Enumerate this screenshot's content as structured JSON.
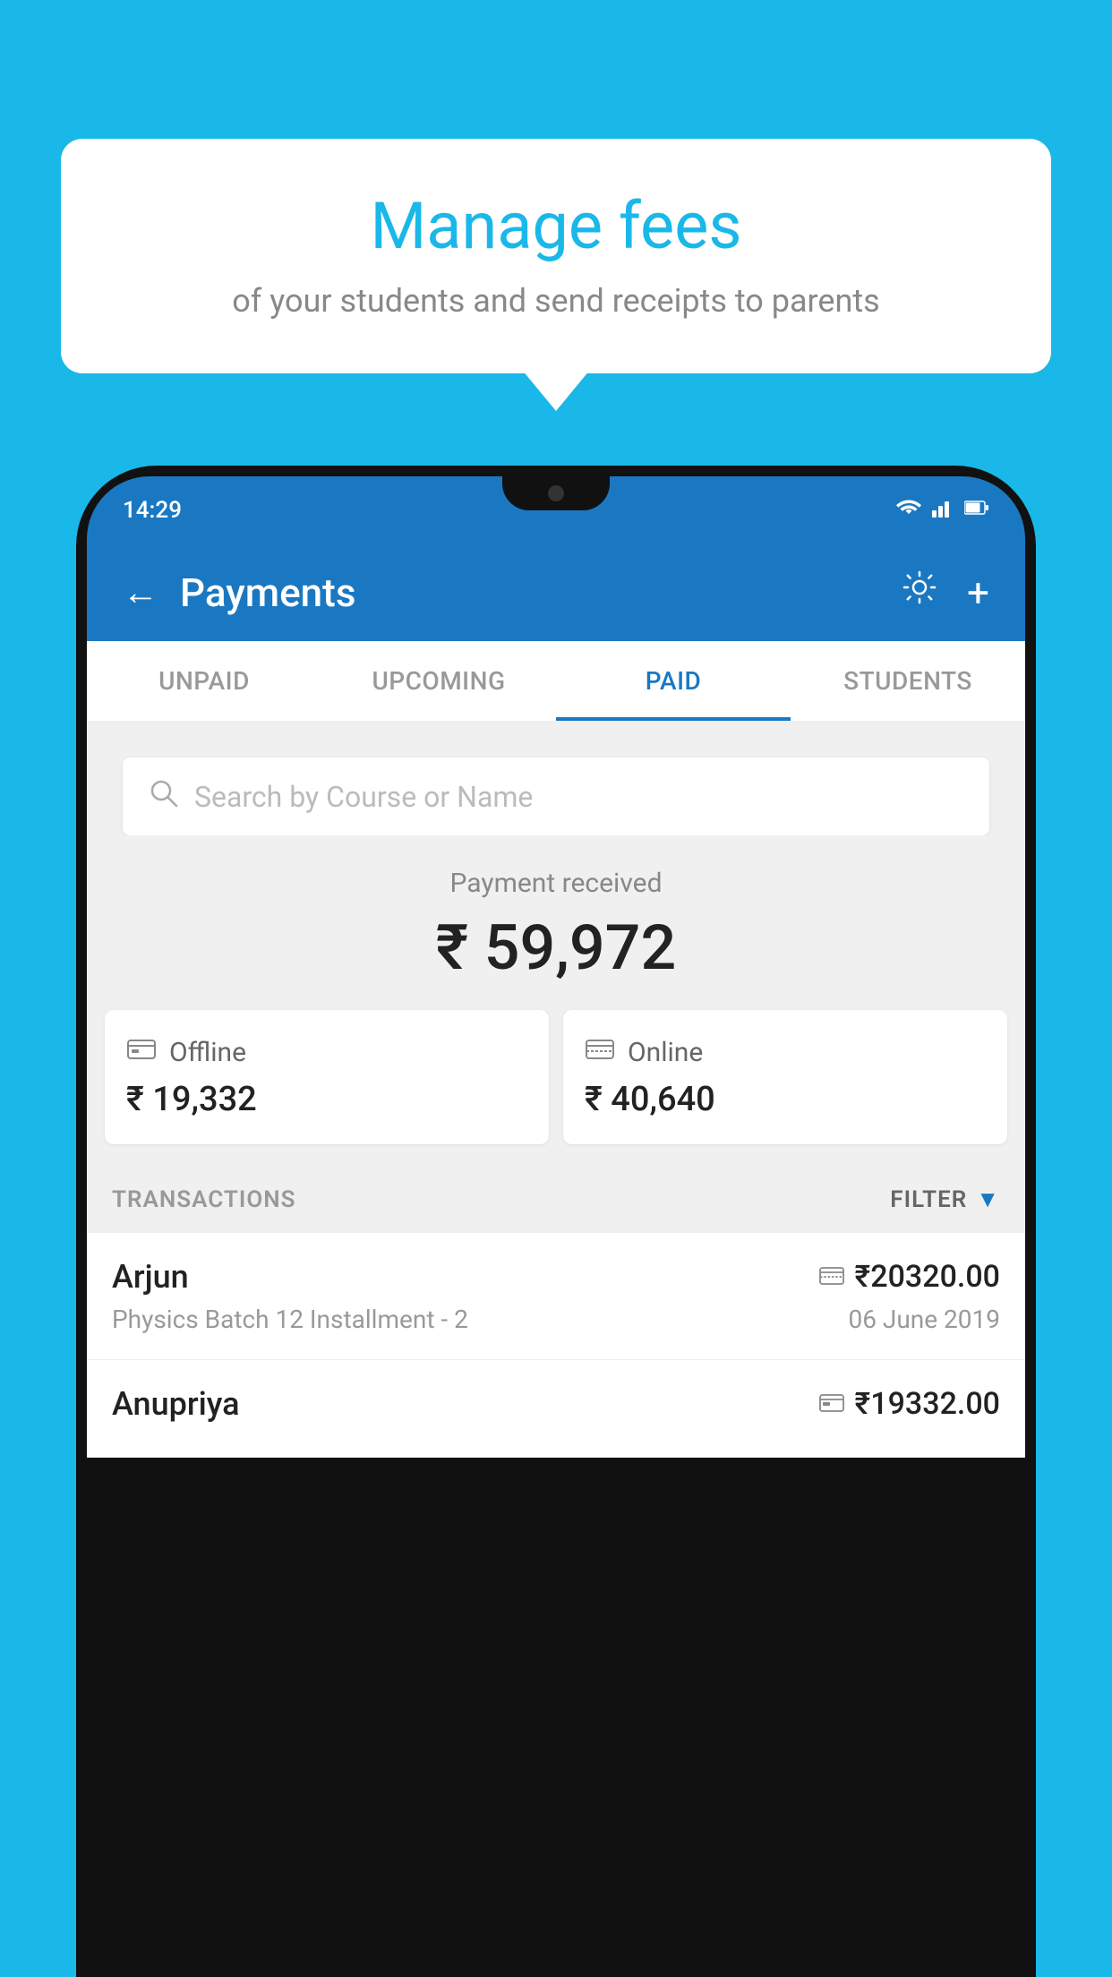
{
  "background_color": "#1ab8e8",
  "speech_bubble": {
    "title": "Manage fees",
    "subtitle": "of your students and send receipts to parents"
  },
  "phone": {
    "status_bar": {
      "time": "14:29",
      "wifi_icon": "wifi",
      "signal_icon": "signal",
      "battery_icon": "battery"
    },
    "header": {
      "back_label": "←",
      "title": "Payments",
      "settings_icon": "gear",
      "add_icon": "+"
    },
    "tabs": [
      {
        "label": "UNPAID",
        "active": false
      },
      {
        "label": "UPCOMING",
        "active": false
      },
      {
        "label": "PAID",
        "active": true
      },
      {
        "label": "STUDENTS",
        "active": false
      }
    ],
    "search": {
      "placeholder": "Search by Course or Name"
    },
    "payment_received": {
      "label": "Payment received",
      "amount": "₹ 59,972"
    },
    "cards": [
      {
        "icon": "cash",
        "label": "Offline",
        "amount": "₹ 19,332"
      },
      {
        "icon": "card",
        "label": "Online",
        "amount": "₹ 40,640"
      }
    ],
    "transactions_section": {
      "label": "TRANSACTIONS",
      "filter_label": "FILTER"
    },
    "transactions": [
      {
        "name": "Arjun",
        "amount": "₹20320.00",
        "description": "Physics Batch 12 Installment - 2",
        "date": "06 June 2019",
        "payment_type": "online"
      },
      {
        "name": "Anupriya",
        "amount": "₹19332.00",
        "description": "",
        "date": "",
        "payment_type": "offline"
      }
    ]
  }
}
